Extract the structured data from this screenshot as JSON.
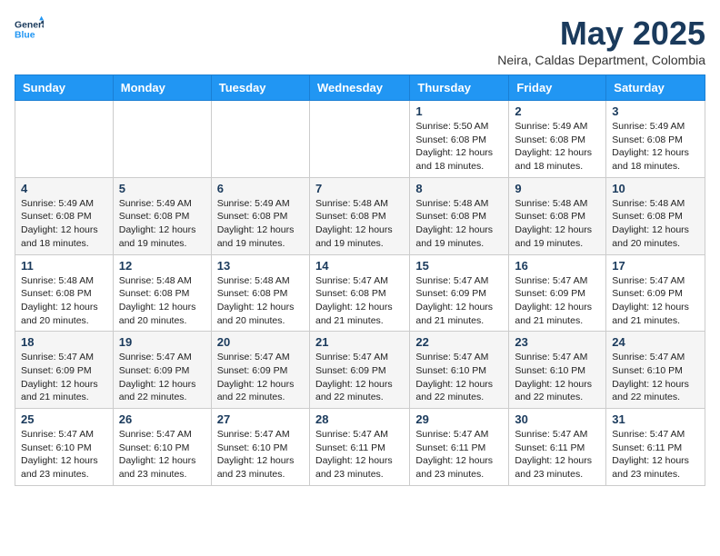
{
  "logo": {
    "line1": "General",
    "line2": "Blue"
  },
  "title": "May 2025",
  "location": "Neira, Caldas Department, Colombia",
  "weekdays": [
    "Sunday",
    "Monday",
    "Tuesday",
    "Wednesday",
    "Thursday",
    "Friday",
    "Saturday"
  ],
  "weeks": [
    [
      {
        "day": "",
        "info": ""
      },
      {
        "day": "",
        "info": ""
      },
      {
        "day": "",
        "info": ""
      },
      {
        "day": "",
        "info": ""
      },
      {
        "day": "1",
        "info": "Sunrise: 5:50 AM\nSunset: 6:08 PM\nDaylight: 12 hours\nand 18 minutes."
      },
      {
        "day": "2",
        "info": "Sunrise: 5:49 AM\nSunset: 6:08 PM\nDaylight: 12 hours\nand 18 minutes."
      },
      {
        "day": "3",
        "info": "Sunrise: 5:49 AM\nSunset: 6:08 PM\nDaylight: 12 hours\nand 18 minutes."
      }
    ],
    [
      {
        "day": "4",
        "info": "Sunrise: 5:49 AM\nSunset: 6:08 PM\nDaylight: 12 hours\nand 18 minutes."
      },
      {
        "day": "5",
        "info": "Sunrise: 5:49 AM\nSunset: 6:08 PM\nDaylight: 12 hours\nand 19 minutes."
      },
      {
        "day": "6",
        "info": "Sunrise: 5:49 AM\nSunset: 6:08 PM\nDaylight: 12 hours\nand 19 minutes."
      },
      {
        "day": "7",
        "info": "Sunrise: 5:48 AM\nSunset: 6:08 PM\nDaylight: 12 hours\nand 19 minutes."
      },
      {
        "day": "8",
        "info": "Sunrise: 5:48 AM\nSunset: 6:08 PM\nDaylight: 12 hours\nand 19 minutes."
      },
      {
        "day": "9",
        "info": "Sunrise: 5:48 AM\nSunset: 6:08 PM\nDaylight: 12 hours\nand 19 minutes."
      },
      {
        "day": "10",
        "info": "Sunrise: 5:48 AM\nSunset: 6:08 PM\nDaylight: 12 hours\nand 20 minutes."
      }
    ],
    [
      {
        "day": "11",
        "info": "Sunrise: 5:48 AM\nSunset: 6:08 PM\nDaylight: 12 hours\nand 20 minutes."
      },
      {
        "day": "12",
        "info": "Sunrise: 5:48 AM\nSunset: 6:08 PM\nDaylight: 12 hours\nand 20 minutes."
      },
      {
        "day": "13",
        "info": "Sunrise: 5:48 AM\nSunset: 6:08 PM\nDaylight: 12 hours\nand 20 minutes."
      },
      {
        "day": "14",
        "info": "Sunrise: 5:47 AM\nSunset: 6:08 PM\nDaylight: 12 hours\nand 21 minutes."
      },
      {
        "day": "15",
        "info": "Sunrise: 5:47 AM\nSunset: 6:09 PM\nDaylight: 12 hours\nand 21 minutes."
      },
      {
        "day": "16",
        "info": "Sunrise: 5:47 AM\nSunset: 6:09 PM\nDaylight: 12 hours\nand 21 minutes."
      },
      {
        "day": "17",
        "info": "Sunrise: 5:47 AM\nSunset: 6:09 PM\nDaylight: 12 hours\nand 21 minutes."
      }
    ],
    [
      {
        "day": "18",
        "info": "Sunrise: 5:47 AM\nSunset: 6:09 PM\nDaylight: 12 hours\nand 21 minutes."
      },
      {
        "day": "19",
        "info": "Sunrise: 5:47 AM\nSunset: 6:09 PM\nDaylight: 12 hours\nand 22 minutes."
      },
      {
        "day": "20",
        "info": "Sunrise: 5:47 AM\nSunset: 6:09 PM\nDaylight: 12 hours\nand 22 minutes."
      },
      {
        "day": "21",
        "info": "Sunrise: 5:47 AM\nSunset: 6:09 PM\nDaylight: 12 hours\nand 22 minutes."
      },
      {
        "day": "22",
        "info": "Sunrise: 5:47 AM\nSunset: 6:10 PM\nDaylight: 12 hours\nand 22 minutes."
      },
      {
        "day": "23",
        "info": "Sunrise: 5:47 AM\nSunset: 6:10 PM\nDaylight: 12 hours\nand 22 minutes."
      },
      {
        "day": "24",
        "info": "Sunrise: 5:47 AM\nSunset: 6:10 PM\nDaylight: 12 hours\nand 22 minutes."
      }
    ],
    [
      {
        "day": "25",
        "info": "Sunrise: 5:47 AM\nSunset: 6:10 PM\nDaylight: 12 hours\nand 23 minutes."
      },
      {
        "day": "26",
        "info": "Sunrise: 5:47 AM\nSunset: 6:10 PM\nDaylight: 12 hours\nand 23 minutes."
      },
      {
        "day": "27",
        "info": "Sunrise: 5:47 AM\nSunset: 6:10 PM\nDaylight: 12 hours\nand 23 minutes."
      },
      {
        "day": "28",
        "info": "Sunrise: 5:47 AM\nSunset: 6:11 PM\nDaylight: 12 hours\nand 23 minutes."
      },
      {
        "day": "29",
        "info": "Sunrise: 5:47 AM\nSunset: 6:11 PM\nDaylight: 12 hours\nand 23 minutes."
      },
      {
        "day": "30",
        "info": "Sunrise: 5:47 AM\nSunset: 6:11 PM\nDaylight: 12 hours\nand 23 minutes."
      },
      {
        "day": "31",
        "info": "Sunrise: 5:47 AM\nSunset: 6:11 PM\nDaylight: 12 hours\nand 23 minutes."
      }
    ]
  ]
}
